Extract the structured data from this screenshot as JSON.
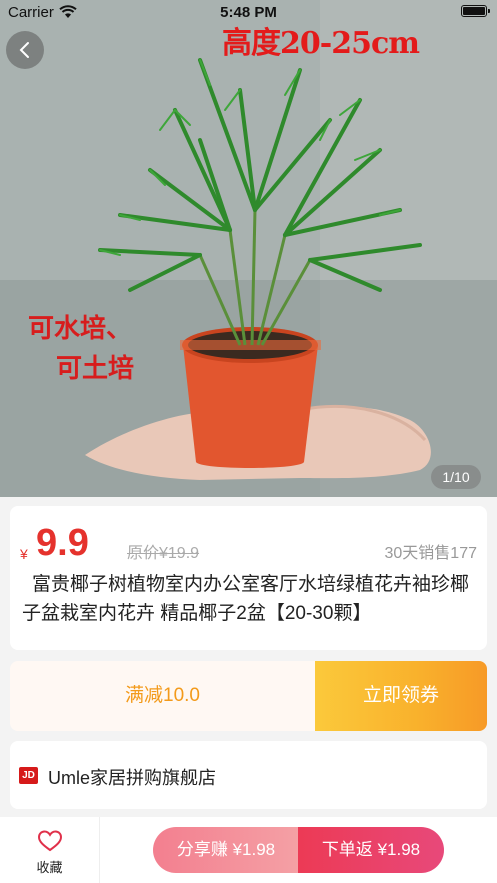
{
  "status_bar": {
    "carrier": "Carrier",
    "time": "5:48 PM"
  },
  "hero": {
    "overlay_title": "高度20-25cm",
    "overlay_side_line1": "可水培、",
    "overlay_side_line2": "可土培",
    "page_indicator": "1/10"
  },
  "product": {
    "currency": "¥",
    "price": "9.9",
    "original_price": "原价¥19.9",
    "sales": "30天销售177",
    "title": "富贵椰子树植物室内办公室客厅水培绿植花卉袖珍椰子盆栽室内花卉 精品椰子2盆【20-30颗】"
  },
  "coupon": {
    "discount": "满减10.0",
    "claim": "立即领券"
  },
  "shop": {
    "logo": "JD",
    "name": "Umle家居拼购旗舰店"
  },
  "bottom_bar": {
    "favorite_label": "收藏",
    "share_label": "分享赚 ¥1.98",
    "order_label": "下单返 ¥1.98"
  },
  "colors": {
    "price_red": "#e5322d",
    "coupon_orange": "#f39a1a",
    "order_pink": "#ec3a55"
  },
  "icons": [
    "back-icon",
    "wifi-icon",
    "battery-icon",
    "heart-icon",
    "jd-logo"
  ]
}
